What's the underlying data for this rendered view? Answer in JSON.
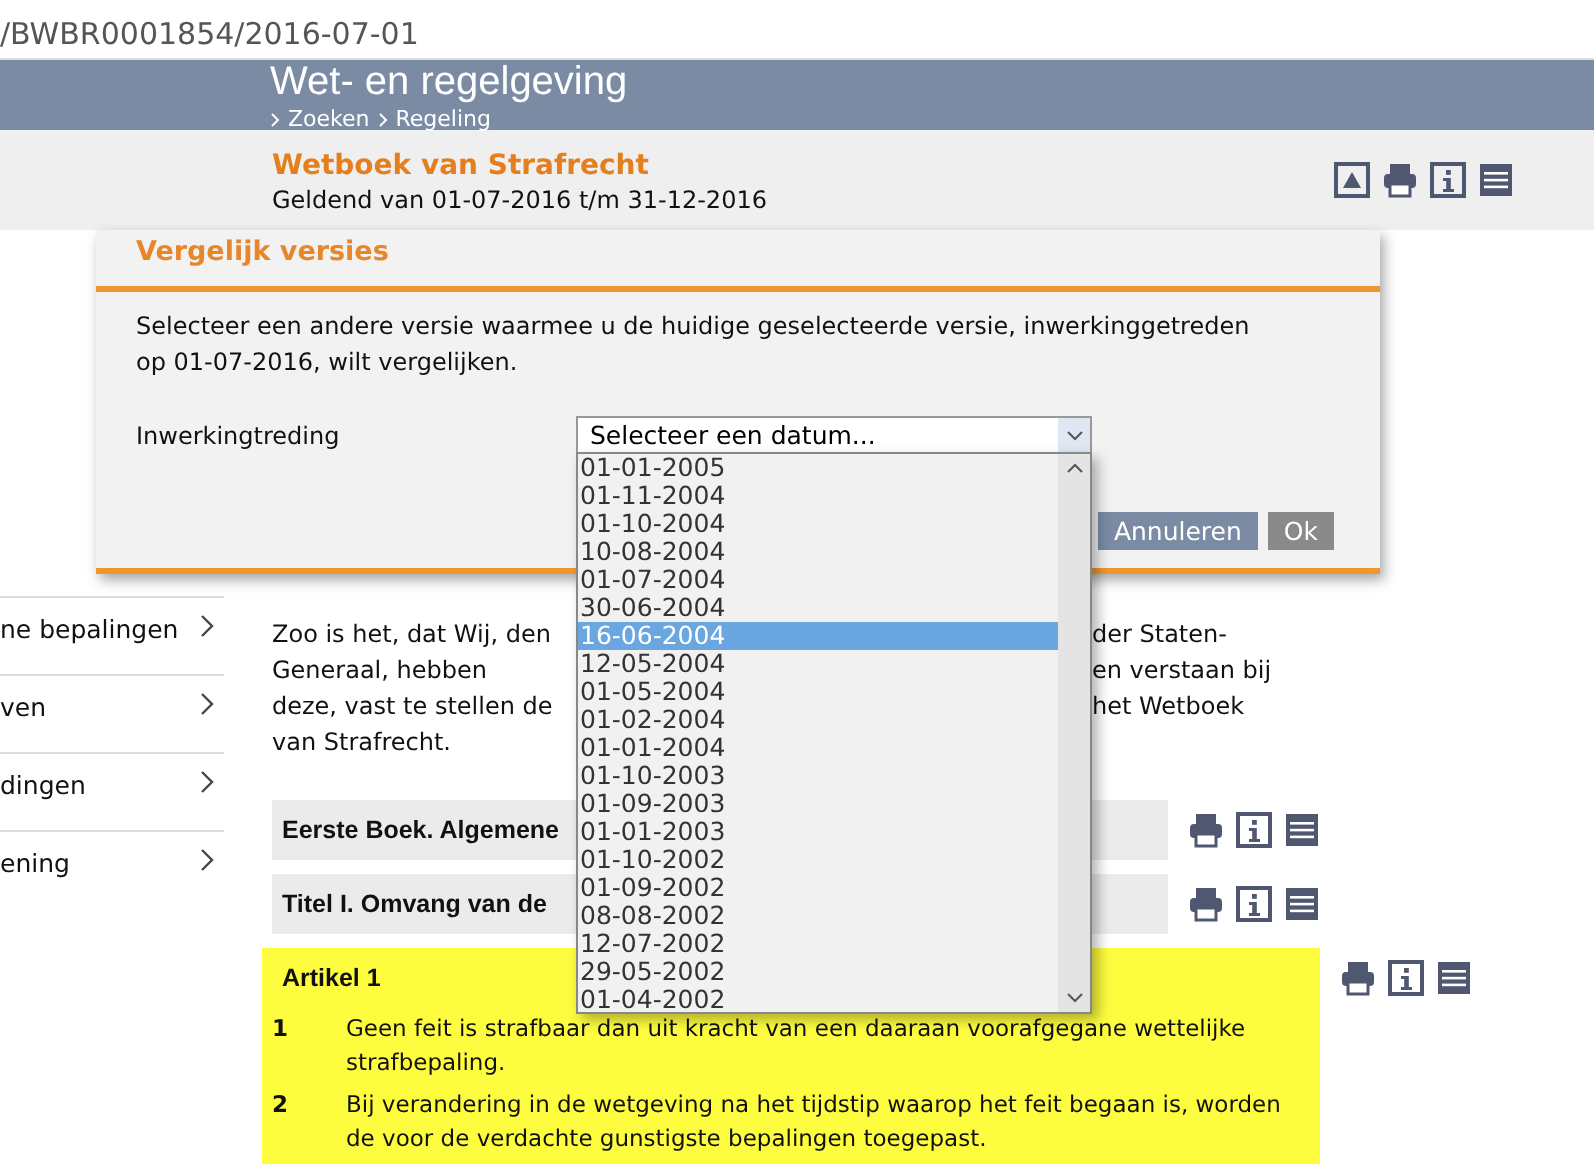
{
  "address_bar": {
    "url": "/BWBR0001854/2016-07-01"
  },
  "header": {
    "title": "Wet- en regelgeving",
    "breadcrumbs": [
      "Zoeken",
      "Regeling"
    ]
  },
  "document": {
    "title": "Wetboek van Strafrecht",
    "validity": "Geldend van 01-07-2016 t/m 31-12-2016"
  },
  "sidebar": {
    "items": [
      "ne bepalingen",
      "ven",
      "dingen",
      "ening"
    ]
  },
  "preamble_lines": [
    {
      "left": "Zoo is het, dat Wij, den",
      "right": "der Staten-"
    },
    {
      "left": "Generaal, hebben",
      "right": "en verstaan bij"
    },
    {
      "left": "deze, vast te stellen de",
      "right": "het Wetboek"
    },
    {
      "left": "van Strafrecht."
    }
  ],
  "sections": [
    {
      "kind": "heading",
      "title": "Eerste Boek. Algemene"
    },
    {
      "kind": "heading",
      "title": "Titel I. Omvang van de"
    },
    {
      "kind": "article",
      "title": "Artikel 1",
      "highlighted": true,
      "paragraphs": [
        {
          "number": "1",
          "text": "Geen feit is strafbaar dan uit kracht van een daaraan voorafgegane wettelijke strafbepaling."
        },
        {
          "number": "2",
          "text": "Bij verandering in de wetgeving na het tijdstip waarop het feit begaan is, worden de voor de verdachte gunstigste bepalingen toegepast."
        }
      ]
    }
  ],
  "dialog": {
    "title": "Vergelijk versies",
    "message": "Selecteer een andere versie waarmee u de huidige geselecteerde versie, inwerkinggetreden op 01-07-2016, wilt vergelijken.",
    "field_label": "Inwerkingtreding",
    "select": {
      "placeholder": "Selecteer een datum...",
      "expanded": true,
      "options": [
        {
          "label": "01-01-2005",
          "selected": false
        },
        {
          "label": "01-11-2004",
          "selected": false
        },
        {
          "label": "01-10-2004",
          "selected": false
        },
        {
          "label": "10-08-2004",
          "selected": false
        },
        {
          "label": "01-07-2004",
          "selected": false
        },
        {
          "label": "30-06-2004",
          "selected": false
        },
        {
          "label": "16-06-2004",
          "selected": true
        },
        {
          "label": "12-05-2004",
          "selected": false
        },
        {
          "label": "01-05-2004",
          "selected": false
        },
        {
          "label": "01-02-2004",
          "selected": false
        },
        {
          "label": "01-01-2004",
          "selected": false
        },
        {
          "label": "01-10-2003",
          "selected": false
        },
        {
          "label": "01-09-2003",
          "selected": false
        },
        {
          "label": "01-01-2003",
          "selected": false
        },
        {
          "label": "01-10-2002",
          "selected": false
        },
        {
          "label": "01-09-2002",
          "selected": false
        },
        {
          "label": "08-08-2002",
          "selected": false
        },
        {
          "label": "12-07-2002",
          "selected": false
        },
        {
          "label": "29-05-2002",
          "selected": false
        },
        {
          "label": "01-04-2002",
          "selected": false
        }
      ]
    },
    "buttons": [
      {
        "label": "Annuleren",
        "kind": "primary"
      },
      {
        "label": "Ok",
        "kind": "secondary"
      }
    ]
  }
}
